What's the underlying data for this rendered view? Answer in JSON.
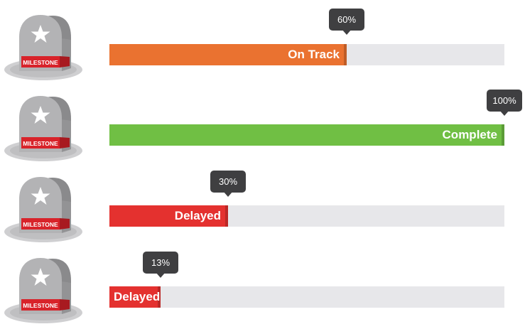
{
  "milestones": [
    {
      "badge": "MILESTONE",
      "status": "On Track",
      "percent_label": "60%",
      "progress": 0.6,
      "color": "#ea7230"
    },
    {
      "badge": "MILESTONE",
      "status": "Complete",
      "percent_label": "100%",
      "progress": 1.0,
      "color": "#70bf44"
    },
    {
      "badge": "MILESTONE",
      "status": "Delayed",
      "percent_label": "30%",
      "progress": 0.3,
      "color": "#e4312f"
    },
    {
      "badge": "MILESTONE",
      "status": "Delayed",
      "percent_label": "13%",
      "progress": 0.13,
      "color": "#e4312f"
    }
  ],
  "colors": {
    "track": "#e7e7ea",
    "bubble": "#3f3f41",
    "stone_light": "#b3b3b5",
    "stone_dark": "#8a8a8c",
    "badge_red": "#d8232a"
  },
  "icons": {
    "stone_icon": "star-icon"
  }
}
